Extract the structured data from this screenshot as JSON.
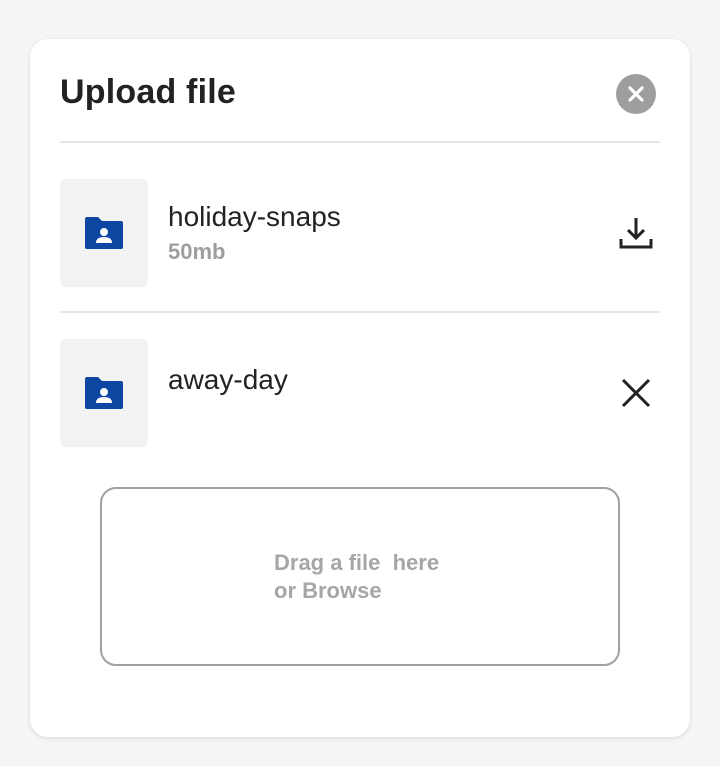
{
  "dialog": {
    "title": "Upload file"
  },
  "files": [
    {
      "name": "holiday-snaps",
      "size": "50mb",
      "action_icon": "download-icon"
    },
    {
      "name": "away-day",
      "size": "",
      "action_icon": "close-icon"
    }
  ],
  "dropzone": {
    "line1": "Drag a file  here",
    "line2": "or Browse"
  },
  "colors": {
    "folder_icon": "#0d47a1",
    "close_button_bg": "#9e9e9e",
    "text_primary": "#222222",
    "text_muted": "#9e9e9e"
  }
}
